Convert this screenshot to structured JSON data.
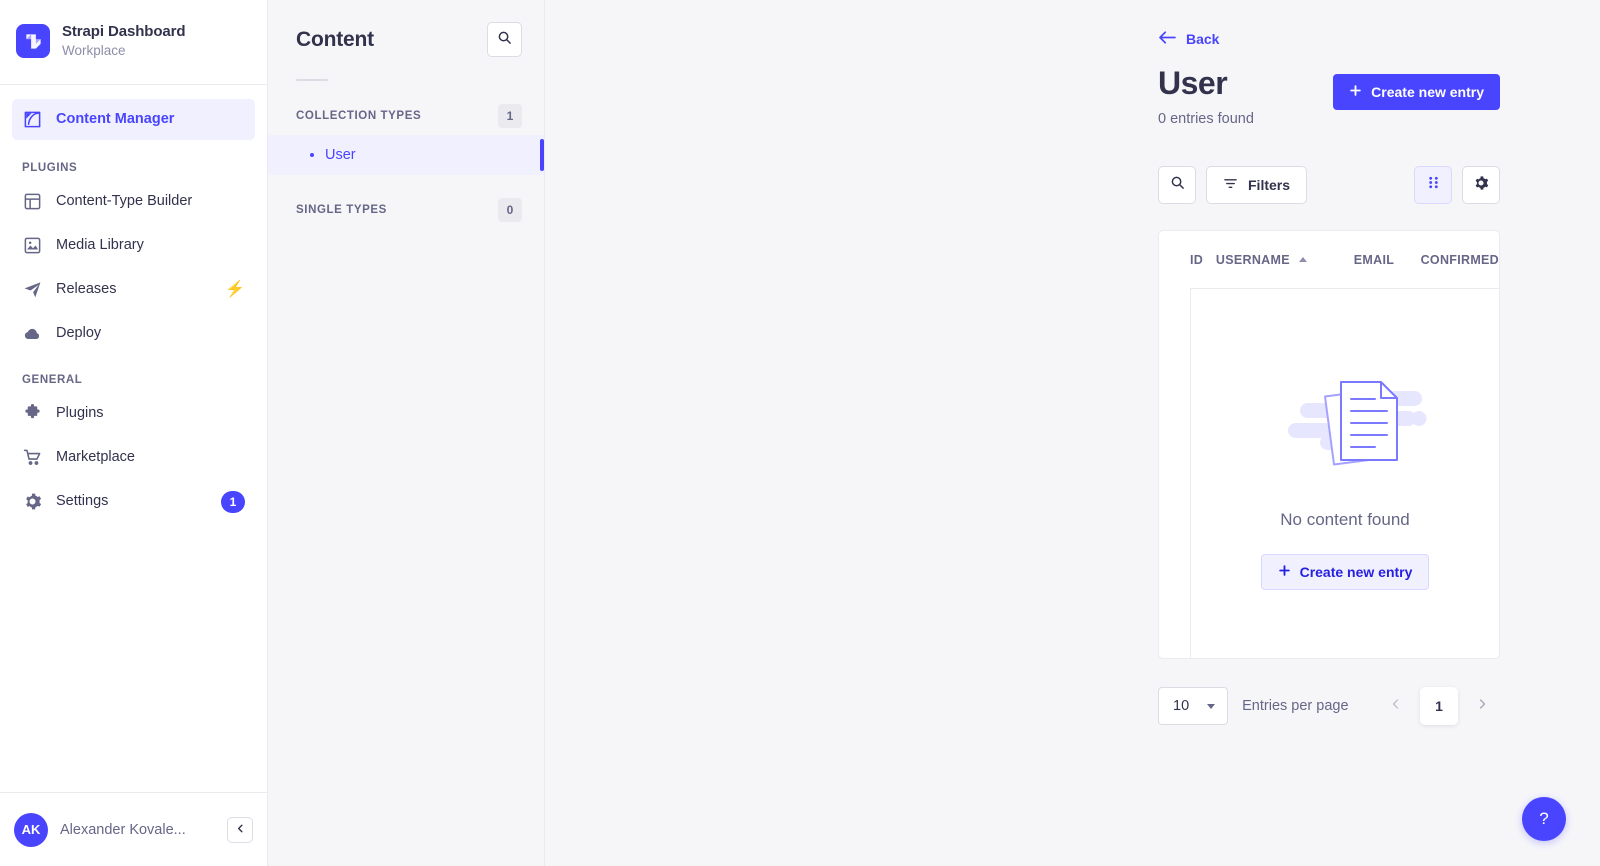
{
  "brand": {
    "title": "Strapi Dashboard",
    "subtitle": "Workplace",
    "logo_icon": "strapi-logo-icon",
    "accent_color": "#4945ff"
  },
  "sidebar": {
    "primary": [
      {
        "label": "Content Manager",
        "icon": "feather-pen-icon",
        "active": true
      }
    ],
    "groups": [
      {
        "label": "PLUGINS",
        "items": [
          {
            "label": "Content-Type Builder",
            "icon": "layout-icon"
          },
          {
            "label": "Media Library",
            "icon": "image-icon"
          },
          {
            "label": "Releases",
            "icon": "paper-plane-icon",
            "badge_icon": "lightning-bolt-icon"
          },
          {
            "label": "Deploy",
            "icon": "cloud-icon"
          }
        ]
      },
      {
        "label": "GENERAL",
        "items": [
          {
            "label": "Plugins",
            "icon": "puzzle-icon"
          },
          {
            "label": "Marketplace",
            "icon": "shopping-cart-icon"
          },
          {
            "label": "Settings",
            "icon": "gear-icon",
            "badge": "1"
          }
        ]
      }
    ],
    "user": {
      "initials": "AK",
      "name": "Alexander Kovale...",
      "collapse_icon": "chevron-left-icon"
    }
  },
  "content_panel": {
    "title": "Content",
    "search_icon": "search-icon",
    "sections": [
      {
        "label": "COLLECTION TYPES",
        "count": "1",
        "items": [
          {
            "label": "User",
            "active": true
          }
        ]
      },
      {
        "label": "SINGLE TYPES",
        "count": "0",
        "items": []
      }
    ]
  },
  "main": {
    "back_label": "Back",
    "back_icon": "arrow-left-icon",
    "title": "User",
    "subtitle": "0 entries found",
    "create_button": "Create new entry",
    "create_icon": "plus-icon",
    "toolbar": {
      "search_icon": "search-icon",
      "filters_label": "Filters",
      "filters_icon": "filter-icon",
      "grid_icon": "grid-dots-icon",
      "settings_icon": "gear-icon"
    },
    "table": {
      "columns": [
        {
          "label": "ID",
          "sorted": false
        },
        {
          "label": "USERNAME",
          "sorted": true,
          "direction": "asc"
        },
        {
          "label": "EMAIL",
          "sorted": false
        },
        {
          "label": "CONFIRMED",
          "sorted": false
        }
      ],
      "rows": []
    },
    "empty_state": {
      "illustration": "documents-illustration",
      "message": "No content found",
      "action_label": "Create new entry",
      "action_icon": "plus-icon"
    },
    "footer": {
      "page_size": "10",
      "page_size_label": "Entries per page",
      "prev_icon": "chevron-left-icon",
      "next_icon": "chevron-right-icon",
      "current_page": "1"
    },
    "help_label": "?"
  }
}
